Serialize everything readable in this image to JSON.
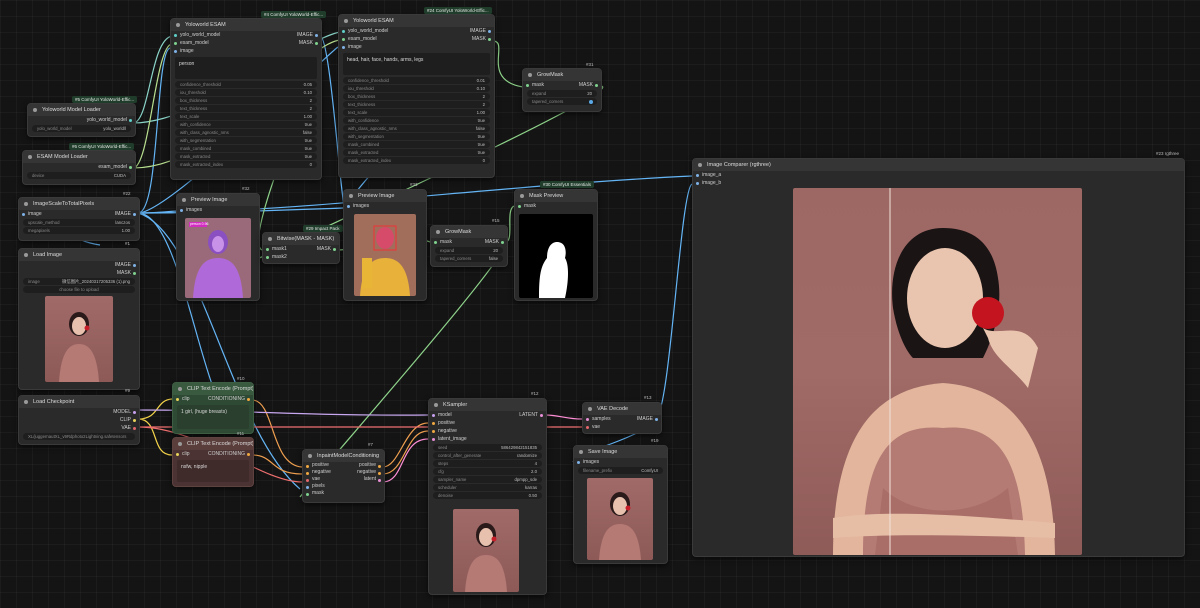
{
  "nodes": {
    "yolo_esam_1": {
      "title": "Yoloworld ESAM",
      "badge": "#4 ComfyUI YoloWorld-Effic...",
      "inputs": [
        "yolo_world_model",
        "esam_model",
        "image"
      ],
      "outputs": [
        "IMAGE",
        "MASK"
      ],
      "prompt": "person",
      "widgets": [
        [
          "confidence_threshold",
          "0.05"
        ],
        [
          "iou_threshold",
          "0.10"
        ],
        [
          "box_thickness",
          "2"
        ],
        [
          "text_thickness",
          "2"
        ],
        [
          "text_scale",
          "1.00"
        ],
        [
          "with_confidence",
          "true"
        ],
        [
          "with_class_agnostic_nms",
          "false"
        ],
        [
          "with_segmentation",
          "true"
        ],
        [
          "mask_combined",
          "true"
        ],
        [
          "mask_extracted",
          "true"
        ],
        [
          "mask_extracted_index",
          "0"
        ]
      ]
    },
    "yolo_esam_2": {
      "title": "Yoloworld ESAM",
      "badge": "#24 ComfyUI YoloWorld-Effic...",
      "inputs": [
        "yolo_world_model",
        "esam_model",
        "image"
      ],
      "outputs": [
        "IMAGE",
        "MASK"
      ],
      "prompt": "head, hair, face, hands, arms, legs",
      "widgets": [
        [
          "confidence_threshold",
          "0.01"
        ],
        [
          "iou_threshold",
          "0.10"
        ],
        [
          "box_thickness",
          "2"
        ],
        [
          "text_thickness",
          "2"
        ],
        [
          "text_scale",
          "1.00"
        ],
        [
          "with_confidence",
          "true"
        ],
        [
          "with_class_agnostic_nms",
          "false"
        ],
        [
          "with_segmentation",
          "true"
        ],
        [
          "mask_combined",
          "true"
        ],
        [
          "mask_extracted",
          "true"
        ],
        [
          "mask_extracted_index",
          "0"
        ]
      ]
    },
    "growmask_31": {
      "title": "GrowMask",
      "badge": "#31",
      "input": "mask",
      "output": "MASK",
      "widgets": [
        [
          "expand",
          "20"
        ],
        [
          "tapered_corners",
          "true"
        ]
      ]
    },
    "yolo_loader": {
      "title": "Yoloworld Model Loader",
      "badge": "#5 ComfyUI YoloWorld-Effic...",
      "output": "yolo_world_model",
      "widget": [
        "yolo_world_model",
        "yolo_world/l"
      ]
    },
    "esam_loader": {
      "title": "ESAM Model Loader",
      "badge": "#6 ComfyUI YoloWorld-Effic...",
      "output": "esam_model",
      "widget": [
        "device",
        "CUDA"
      ]
    },
    "image_scale": {
      "title": "ImageScaleToTotalPixels",
      "badge": "#22",
      "input": "image",
      "output": "IMAGE",
      "widgets": [
        [
          "upscale_method",
          "lanczos"
        ],
        [
          "megapixels",
          "1.00"
        ]
      ]
    },
    "load_image": {
      "title": "Load Image",
      "badge": "#1",
      "outputs": [
        "IMAGE",
        "MASK"
      ],
      "file": "微信图片_20240317205336 (1).png",
      "upload": "choose file to upload"
    },
    "preview_32": {
      "title": "Preview Image",
      "badge": "#32",
      "input": "images",
      "label_tag": "person 0.96"
    },
    "bitwise": {
      "title": "Bitwise(MASK - MASK)",
      "badge": "#29 Impact Pack",
      "inputs": [
        "mask1",
        "mask2"
      ],
      "output": "MASK"
    },
    "preview_33": {
      "title": "Preview Image",
      "badge": "#33",
      "input": "images"
    },
    "growmask_15": {
      "title": "GrowMask",
      "badge": "#15",
      "input": "mask",
      "output": "MASK",
      "widgets": [
        [
          "expand",
          "20"
        ],
        [
          "tapered_corners",
          "false"
        ]
      ]
    },
    "mask_preview": {
      "title": "Mask Preview",
      "badge": "#30 ComfyUI Essentials",
      "input": "mask"
    },
    "image_comparer": {
      "title": "Image Comparer (rgthree)",
      "badge": "#23 rgthree",
      "inputs": [
        "image_a",
        "image_b"
      ]
    },
    "clip_pos": {
      "title": "CLIP Text Encode (Prompt)",
      "badge": "#10",
      "input": "clip",
      "output": "CONDITIONING",
      "text": "1 girl, (huge breasts)"
    },
    "clip_neg": {
      "title": "CLIP Text Encode (Prompt)",
      "badge": "#11",
      "input": "clip",
      "output": "CONDITIONING",
      "text": "nsfw, nipple"
    },
    "load_checkpoint": {
      "title": "Load Checkpoint",
      "badge": "#9",
      "outputs": [
        "MODEL",
        "CLIP",
        "VAE"
      ],
      "ckpt": "XL/juggernautXL_v9Rdphoto2Lightning.safetensors"
    },
    "inpaint_cond": {
      "title": "InpaintModelConditioning",
      "badge": "#7",
      "inputs": [
        "positive",
        "negative",
        "vae",
        "pixels",
        "mask"
      ],
      "outputs": [
        "positive",
        "negative",
        "latent"
      ]
    },
    "ksampler": {
      "title": "KSampler",
      "badge": "#12",
      "inputs": [
        "model",
        "positive",
        "negative",
        "latent_image"
      ],
      "output": "LATENT",
      "widgets": [
        [
          "seed",
          "586429842151835"
        ],
        [
          "control_after_generate",
          "randomize"
        ],
        [
          "steps",
          "4"
        ],
        [
          "cfg",
          "2.0"
        ],
        [
          "sampler_name",
          "dpmpp_sde"
        ],
        [
          "scheduler",
          "karras"
        ],
        [
          "denoise",
          "0.50"
        ]
      ]
    },
    "vae_decode": {
      "title": "VAE Decode",
      "badge": "#13",
      "inputs": [
        "samples",
        "vae"
      ],
      "output": "IMAGE"
    },
    "save_image": {
      "title": "Save Image",
      "badge": "#19",
      "input": "images",
      "widget": [
        "filename_prefix",
        "ComfyUI"
      ]
    }
  },
  "colors": {
    "canvas": "#141414",
    "node": "#2a2a2a",
    "header": "#353535",
    "clip_pos": "#2f4a34",
    "clip_neg": "#4a3332",
    "image_wire": "#64b5f6",
    "mask_wire": "#8ed38a",
    "clip_wire": "#f3d34a",
    "cond_wire": "#f0a050",
    "model_wire": "#c8a8f0",
    "latent_wire": "#ff8ed6",
    "vae_wire": "#ef6f6f"
  }
}
